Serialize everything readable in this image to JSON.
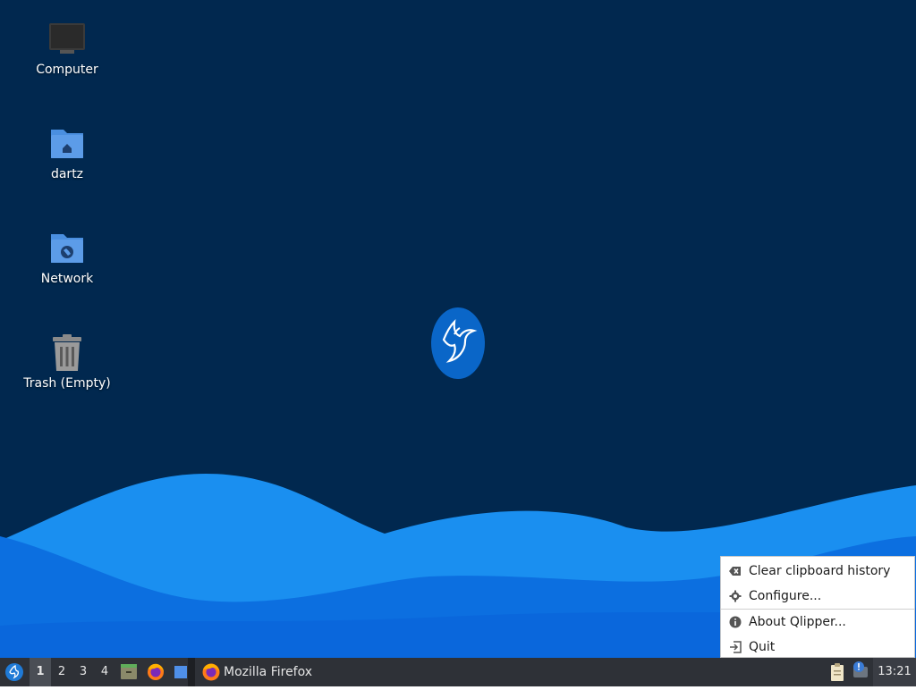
{
  "desktop": {
    "icons": [
      {
        "label": "Computer",
        "icon": "computer-icon"
      },
      {
        "label": "dartz",
        "icon": "home-folder-icon"
      },
      {
        "label": "Network",
        "icon": "network-folder-icon"
      },
      {
        "label": "Trash (Empty)",
        "icon": "trash-icon"
      }
    ],
    "colors": {
      "background": "#01284f",
      "wave_light": "#1a8ff0",
      "wave_mid": "#0f78e6",
      "wave_dark": "#0a62d8"
    }
  },
  "context_menu": {
    "items": [
      {
        "label": "Clear clipboard history",
        "icon": "clear-icon"
      },
      {
        "label": "Configure...",
        "icon": "gear-icon"
      },
      {
        "label": "About Qlipper...",
        "icon": "info-icon"
      },
      {
        "label": "Quit",
        "icon": "quit-icon"
      }
    ]
  },
  "taskbar": {
    "workspaces": [
      "1",
      "2",
      "3",
      "4"
    ],
    "active_workspace": "1",
    "launchers": [
      "file-manager-icon",
      "firefox-icon",
      "show-desktop-icon"
    ],
    "task": {
      "label": "Mozilla Firefox",
      "icon": "firefox-icon"
    },
    "tray": [
      "clipboard-icon",
      "notification-icon"
    ],
    "clock": "13:21"
  }
}
